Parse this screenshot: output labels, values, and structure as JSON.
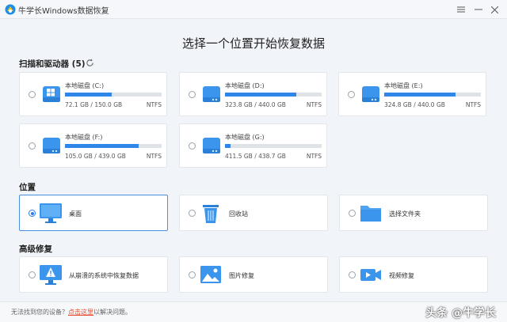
{
  "app": {
    "title": "牛学长Windows数据恢复"
  },
  "page_title": "选择一个位置开始恢复数据",
  "drives_section": {
    "label": "扫描和驱动器 (5)"
  },
  "drives": [
    {
      "name": "本地磁盘 (C:)",
      "size": "72.1 GB / 150.0 GB",
      "fs": "NTFS",
      "used_fraction": 0.48
    },
    {
      "name": "本地磁盘 (D:)",
      "size": "323.8 GB / 440.0 GB",
      "fs": "NTFS",
      "used_fraction": 0.736
    },
    {
      "name": "本地磁盘 (E:)",
      "size": "324.8 GB / 440.0 GB",
      "fs": "NTFS",
      "used_fraction": 0.738
    },
    {
      "name": "本地磁盘 (F:)",
      "size": "105.0 GB / 439.0 GB",
      "fs": "NTFS",
      "used_fraction": 0.76
    },
    {
      "name": "本地磁盘 (G:)",
      "size": "411.5 GB / 438.7 GB",
      "fs": "NTFS",
      "used_fraction": 0.06
    }
  ],
  "location_section": {
    "label": "位置"
  },
  "locations": [
    {
      "label": "桌面",
      "icon": "monitor-icon",
      "selected": true
    },
    {
      "label": "回收站",
      "icon": "recycle-bin-icon",
      "selected": false
    },
    {
      "label": "选择文件夹",
      "icon": "folder-icon",
      "selected": false
    }
  ],
  "advanced_section": {
    "label": "高级修复"
  },
  "advanced": [
    {
      "label": "从崩溃的系统中恢复数据",
      "icon": "crashed-system-icon"
    },
    {
      "label": "图片修复",
      "icon": "photo-icon"
    },
    {
      "label": "视频修复",
      "icon": "video-icon"
    }
  ],
  "footer": {
    "prefix": "无法找到您的设备？",
    "link": "点击这里",
    "suffix": "以解决问题。"
  },
  "watermark": "头条 @牛学长",
  "colors": {
    "accent": "#2f86e8",
    "link": "#e64a2e",
    "selected_border": "#4a90e2"
  }
}
